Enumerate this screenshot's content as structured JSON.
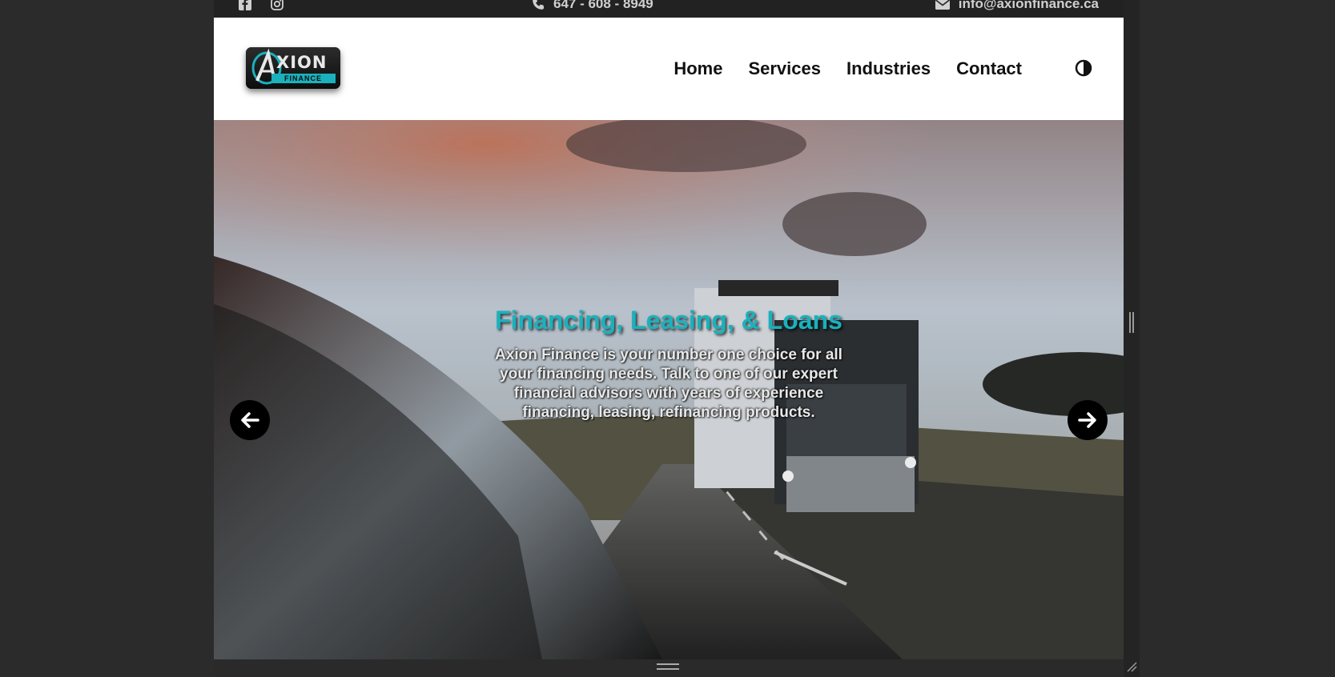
{
  "topbar": {
    "social_icons": [
      "facebook-icon",
      "instagram-icon"
    ],
    "phone_icon": "phone-icon",
    "phone": "647 - 608 - 8949",
    "email_icon": "envelope-icon",
    "email": "info@axionfinance.ca"
  },
  "header": {
    "logo": {
      "line1": "XION",
      "line2": "FINANCE",
      "letter": "A"
    },
    "nav": [
      {
        "label": "Home"
      },
      {
        "label": "Services"
      },
      {
        "label": "Industries"
      },
      {
        "label": "Contact"
      }
    ],
    "theme_toggle_icon": "half-circle-contrast-icon"
  },
  "hero": {
    "title": "Financing, Leasing, & Loans",
    "text": "Axion Finance is your number one choice for all your financing needs. Talk to one of our expert financial advisors with years of experience financing, leasing, refinancing products.",
    "prev_icon": "arrow-left-icon",
    "next_icon": "arrow-right-icon"
  },
  "colors": {
    "accent": "#1ab1bd",
    "page_bg": "#2b2b2b",
    "header_bg": "#ffffff"
  }
}
